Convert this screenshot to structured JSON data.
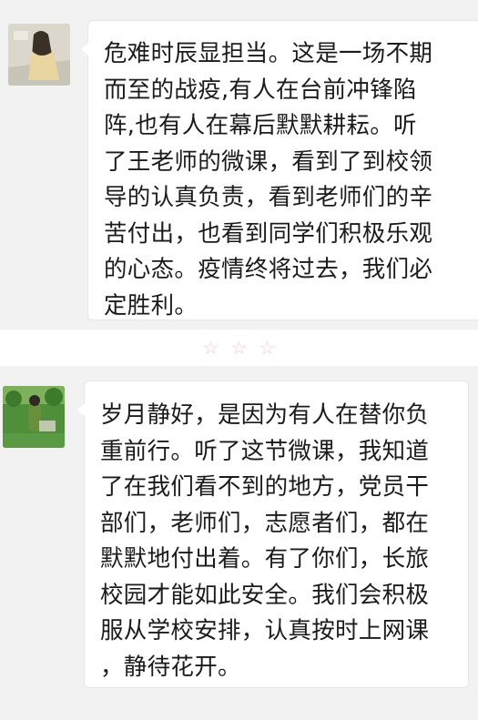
{
  "messages": [
    {
      "avatar": "avatar-photo-person",
      "lines": [
        "危难时辰显担当。这是一场不期",
        "而至的战疫,有人在台前冲锋陷",
        "阵,也有人在幕后默默耕耘。听",
        "了王老师的微课，看到了到校领",
        "导的认真负责，看到老师们的辛",
        "苦付出，也看到同学们积极乐观",
        "的心态。疫情终将过去，我们必",
        "定胜利。"
      ]
    },
    {
      "avatar": "avatar-photo-garden",
      "lines": [
        "岁月静好，是因为有人在替你负",
        "重前行。听了这节微课，我知道",
        "了在我们看不到的地方，党员干",
        "部们，老师们，志愿者们，都在",
        "默默地付出着。有了你们，长旅",
        "校园才能如此安全。我们会积极",
        "服从学校安排，认真按时上网课",
        "，静待花开。"
      ]
    }
  ],
  "divider": {
    "glyphs": "☆☆☆",
    "color": "#f7c8d5"
  }
}
